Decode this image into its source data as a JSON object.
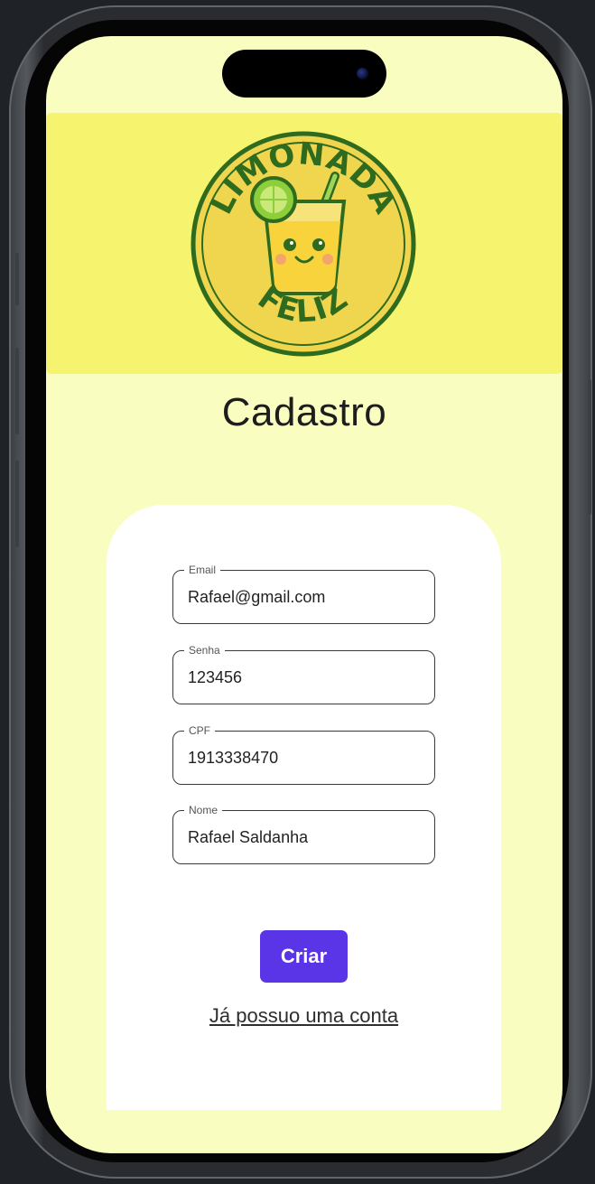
{
  "logo": {
    "top_text": "LIMONADA",
    "bottom_text": "FELIZ"
  },
  "page": {
    "title": "Cadastro"
  },
  "form": {
    "fields": [
      {
        "label": "Email",
        "value": "Rafael@gmail.com"
      },
      {
        "label": "Senha",
        "value": "123456"
      },
      {
        "label": "CPF",
        "value": "1913338470"
      },
      {
        "label": "Nome",
        "value": "Rafael Saldanha"
      }
    ],
    "submit_label": "Criar",
    "login_link": "Já possuo uma conta"
  },
  "colors": {
    "screen_background": "#fafdc0",
    "header_band": "#f6f36e",
    "button": "#5a35e8",
    "logo_green": "#2f6b1f"
  }
}
